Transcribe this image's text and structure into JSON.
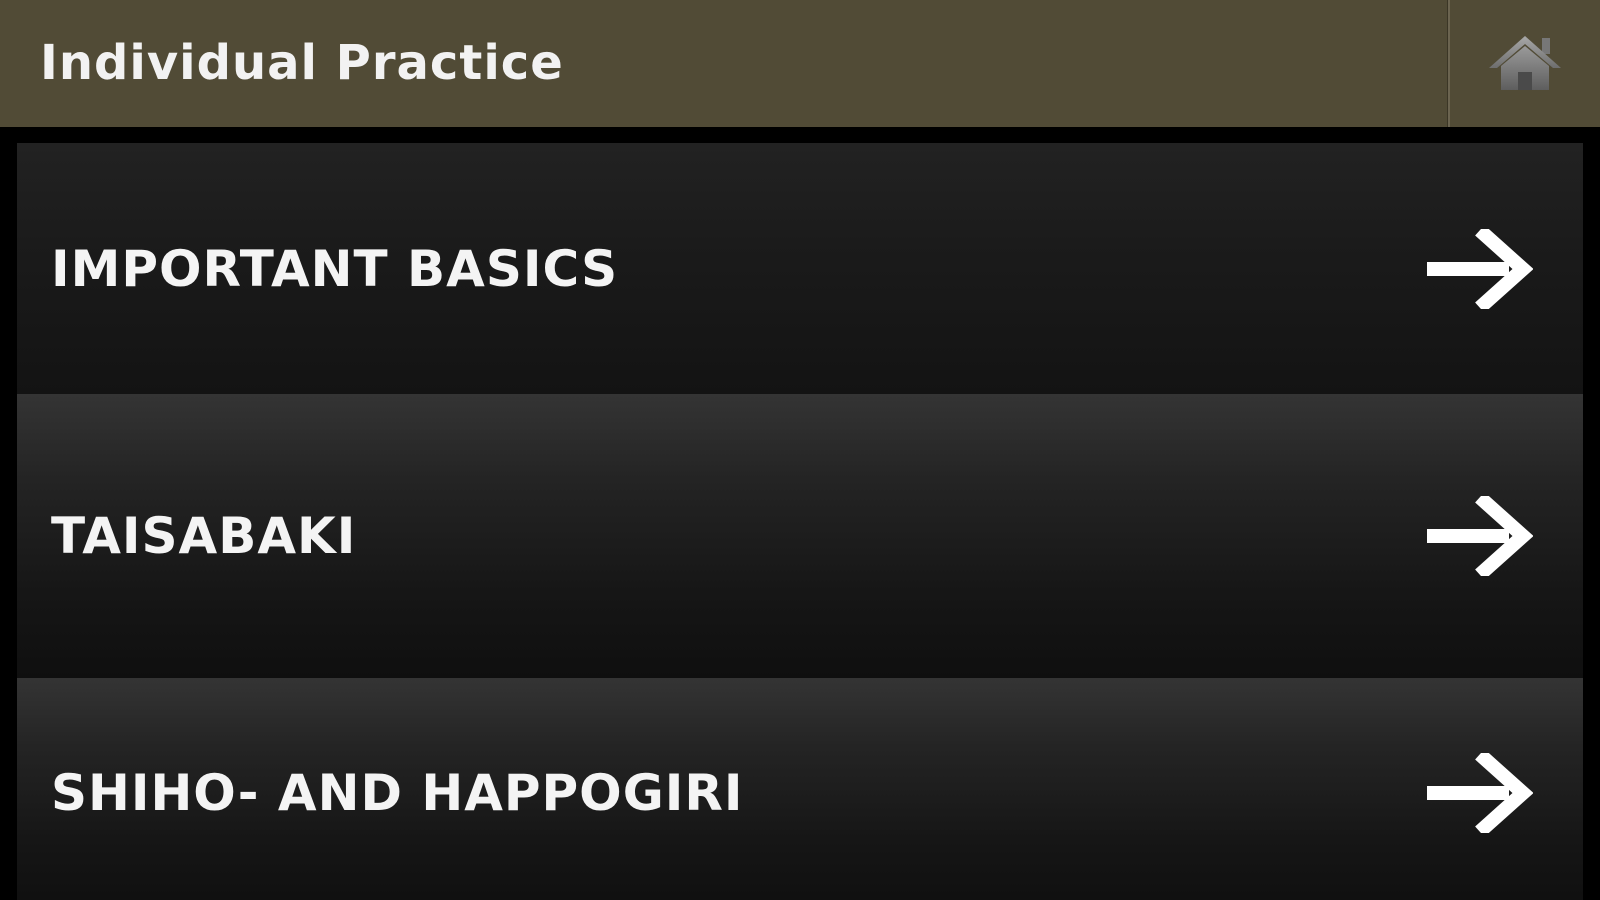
{
  "header": {
    "title": "Individual Practice",
    "home_icon": "home-icon",
    "background_color": "#514b36"
  },
  "list": {
    "items": [
      {
        "label": "IMPORTANT BASICS",
        "icon": "arrow-right-icon"
      },
      {
        "label": "TAISABAKI",
        "icon": "arrow-right-icon"
      },
      {
        "label": "SHIHO- AND HAPPOGIRI",
        "icon": "arrow-right-icon"
      }
    ]
  }
}
